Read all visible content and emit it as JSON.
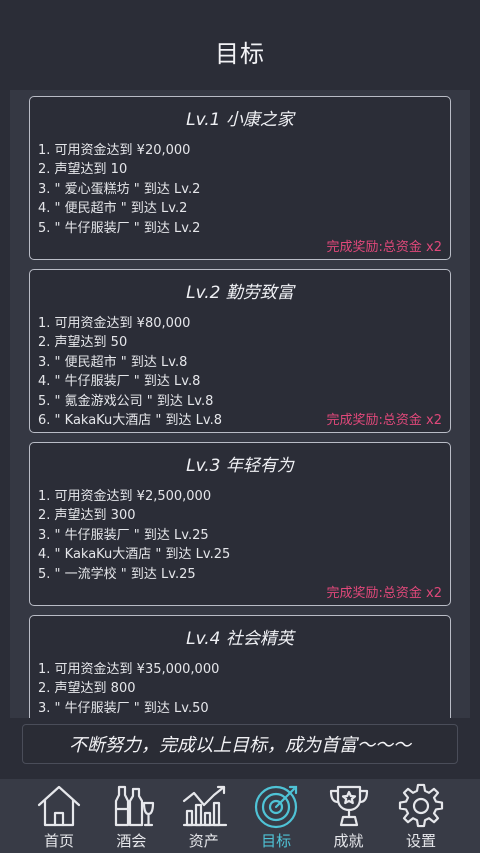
{
  "header": {
    "title": "目标"
  },
  "goals": [
    {
      "title": "Lv.1 小康之家",
      "requirements": [
        "1. 可用资金达到 ¥20,000",
        "2. 声望达到 10",
        "3. \" 爱心蛋糕坊 \" 到达 Lv.2",
        "4. \" 便民超市 \" 到达 Lv.2",
        "5. \" 牛仔服装厂 \" 到达 Lv.2"
      ],
      "reward": "完成奖励:总资金 x2"
    },
    {
      "title": "Lv.2 勤劳致富",
      "requirements": [
        "1. 可用资金达到 ¥80,000",
        "2. 声望达到 50",
        "3. \" 便民超市 \" 到达 Lv.8",
        "4. \" 牛仔服装厂 \" 到达 Lv.8",
        "5. \" 氪金游戏公司 \" 到达 Lv.8",
        "6. \" KakaKu大酒店 \" 到达 Lv.8"
      ],
      "reward": "完成奖励:总资金 x2"
    },
    {
      "title": "Lv.3 年轻有为",
      "requirements": [
        "1. 可用资金达到 ¥2,500,000",
        "2. 声望达到 300",
        "3. \" 牛仔服装厂 \" 到达 Lv.25",
        "4. \" KakaKu大酒店 \" 到达 Lv.25",
        "5. \" 一流学校 \" 到达 Lv.25"
      ],
      "reward": "完成奖励:总资金 x2"
    },
    {
      "title": "Lv.4 社会精英",
      "requirements": [
        "1. 可用资金达到 ¥35,000,000",
        "2. 声望达到 800",
        "3. \" 牛仔服装厂 \" 到达 Lv.50"
      ],
      "reward": ""
    }
  ],
  "motto": "不断努力，完成以上目标，成为首富～～～",
  "nav": {
    "active_color": "#4fc3d6",
    "items": [
      {
        "label": "首页",
        "icon": "home-icon"
      },
      {
        "label": "酒会",
        "icon": "wine-bottles-icon"
      },
      {
        "label": "资产",
        "icon": "growth-chart-icon"
      },
      {
        "label": "目标",
        "icon": "target-icon",
        "active": true
      },
      {
        "label": "成就",
        "icon": "trophy-icon"
      },
      {
        "label": "设置",
        "icon": "gear-icon"
      }
    ]
  },
  "colors": {
    "reward": "#e0487a",
    "background": "#2b2d37"
  }
}
